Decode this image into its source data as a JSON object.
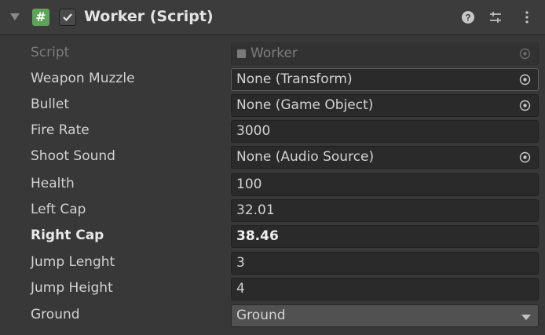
{
  "header": {
    "title": "Worker (Script)",
    "script_icon_glyph": "#",
    "enabled": true,
    "icons": [
      "help-icon",
      "preset-icon",
      "context-menu-icon"
    ]
  },
  "fields": [
    {
      "label": "Script",
      "value": "Worker",
      "type": "script",
      "disabled": true
    },
    {
      "label": "Weapon Muzzle",
      "value": "None (Transform)",
      "type": "object"
    },
    {
      "label": "Bullet",
      "value": "None (Game Object)",
      "type": "object"
    },
    {
      "label": "Fire Rate",
      "value": "3000",
      "type": "number"
    },
    {
      "label": "Shoot Sound",
      "value": "None (Audio Source)",
      "type": "object"
    },
    {
      "label": "Health",
      "value": "100",
      "type": "number"
    },
    {
      "label": "Left Cap",
      "value": "32.01",
      "type": "number"
    },
    {
      "label": "Right Cap",
      "value": "38.46",
      "type": "number",
      "bold": true
    },
    {
      "label": "Jump Lenght",
      "value": "3",
      "type": "number"
    },
    {
      "label": "Jump Height",
      "value": "4",
      "type": "number"
    },
    {
      "label": "Ground",
      "value": "Ground",
      "type": "dropdown"
    }
  ],
  "colors": {
    "panel_bg": "#383838",
    "header_bg": "#3c3c3c",
    "field_bg": "#2a2a2a",
    "dropdown_bg": "#515151",
    "script_icon": "#5fa35a",
    "text": "#d2d2d2"
  }
}
